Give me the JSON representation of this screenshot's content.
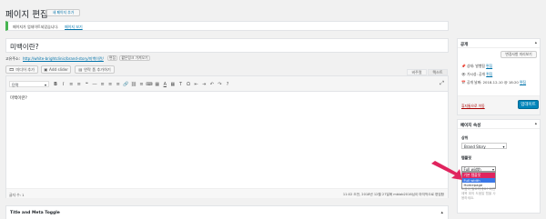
{
  "header": {
    "title": "페이지 편집",
    "add_new": "새 페이지 추가"
  },
  "notice": {
    "text": "페이지가 업데이트되었습니다.",
    "link": "페이지 보기"
  },
  "post": {
    "title": "미백이란?",
    "permalink_label": "고유주소:",
    "permalink_url": "http://white-brightclinic/brand-story/미백이란/",
    "edit_btn": "편집",
    "short_link_btn": "짧은링크 가져오기"
  },
  "media": {
    "add_media": "미디어 추가",
    "add_slider": "Add slider",
    "add_form": "연락 폼 추가하기"
  },
  "editor_tabs": {
    "visual": "비주얼",
    "text": "텍스트"
  },
  "toolbar": {
    "format_select": "단락",
    "icons": [
      "B",
      "I",
      "≡",
      "≡",
      "❝",
      "―",
      "≡",
      "≡",
      "≡",
      "🔗",
      "⛓",
      "≡",
      "⌨",
      "▦",
      "A",
      "▦",
      "T",
      "Ω",
      "⇤",
      "⇥",
      "↶",
      "↷",
      "?"
    ]
  },
  "content": {
    "body": "미백이란?"
  },
  "editor_status": {
    "word_count": "글자 수: 1",
    "last_edited": "11:02 오전, 2018년 12월 27일에 mblab2016님이 마지막으로 편집함"
  },
  "meta_box": {
    "title": "Title and Meta Toggle"
  },
  "publish": {
    "title": "공개",
    "preview_btn": "변경사항 미리보기",
    "status": "상태: 발행됨",
    "status_edit": "편집",
    "visibility": "가시성: 공개",
    "visibility_edit": "편집",
    "published": "공개 날짜: 2018-12-10 @ 18:20",
    "published_edit": "편집",
    "trash": "휴지통으로 이동",
    "update_btn": "업데이트"
  },
  "attributes": {
    "title": "페이지 속성",
    "parent_label": "상위",
    "parent_value": "Brand Story",
    "template_label": "템플릿",
    "template_value": "Full width",
    "options": [
      "기본 템플릿",
      "Full width",
      "Homepage"
    ],
    "help_text": "도움이 필요하세요? 화면 제목 위의 도움말 탭을 사용하세요."
  },
  "colors": {
    "accent": "#0085ba",
    "highlight": "#e0245e",
    "arrow": "#e0245e",
    "option_selected": "#3b78e7"
  }
}
